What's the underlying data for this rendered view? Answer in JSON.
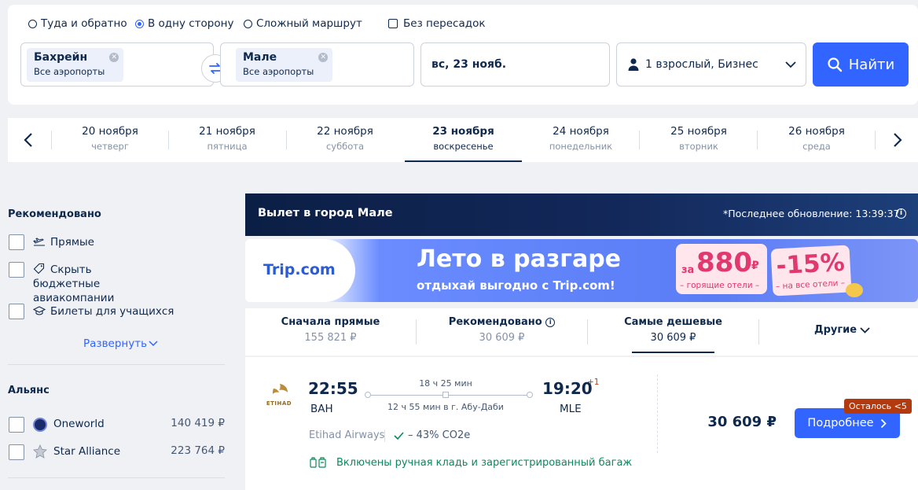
{
  "search": {
    "trip_types": [
      "Туда и обратно",
      "В одну сторону",
      "Сложный маршрут"
    ],
    "nonstop_label": "Без пересадок",
    "from": {
      "city": "Бахрейн",
      "sub": "Все аэропорты"
    },
    "to": {
      "city": "Мале",
      "sub": "Все аэропорты"
    },
    "date": "вс, 23 нояб.",
    "passengers": "1 взрослый, Бизнес",
    "find_label": "Найти"
  },
  "dates": [
    {
      "day": "20 ноября",
      "weekday": "четверг"
    },
    {
      "day": "21 ноября",
      "weekday": "пятница"
    },
    {
      "day": "22 ноября",
      "weekday": "суббота"
    },
    {
      "day": "23 ноября",
      "weekday": "воскресенье"
    },
    {
      "day": "24 ноября",
      "weekday": "понедельник"
    },
    {
      "day": "25 ноября",
      "weekday": "вторник"
    },
    {
      "day": "26 ноября",
      "weekday": "среда"
    }
  ],
  "filters": {
    "recommended_title": "Рекомендовано",
    "recommended": [
      "Прямые",
      "Скрыть бюджетные авиакомпании",
      "Билеты для учащихся"
    ],
    "expand_label": "Развернуть",
    "alliance_title": "Альянс",
    "alliances": [
      {
        "name": "Oneworld",
        "price": "140 419 ₽"
      },
      {
        "name": "Star Alliance",
        "price": "223 764 ₽"
      }
    ]
  },
  "results": {
    "header_title": "Вылет в город Мале",
    "last_update": "*Последнее обновление: 13:39:37",
    "banner": {
      "logo": "Trip.com",
      "headline": "Лето в разгаре",
      "subline": "отдыхай выгодно с Trip.com!",
      "price_prefix": "за",
      "price": "880",
      "price_currency": "₽",
      "price_note": "– горящие отели –",
      "discount": "-15%",
      "discount_note": "– на все отели –"
    },
    "sort_tabs": [
      {
        "title": "Сначала прямые",
        "price": "155 821 ₽"
      },
      {
        "title": "Рекомендовано",
        "price": "30 609 ₽"
      },
      {
        "title": "Самые дешевые",
        "price": "30 609 ₽"
      },
      {
        "title": "Другие",
        "price": ""
      }
    ],
    "flight": {
      "logo_text": "ETIHAD",
      "dep_time": "22:55",
      "dep_code": "BAH",
      "duration": "18 ч 25 мин",
      "stop": "12 ч 55 мин в г. Абу-Даби",
      "arr_time": "19:20",
      "arr_plus": "+1",
      "arr_code": "MLE",
      "airline": "Etihad Airways",
      "co2": "– 43% CO2e",
      "baggage": "Включены ручная кладь и зарегистрированный багаж",
      "price": "30 609 ₽",
      "badge": "Осталось <5",
      "details_label": "Подробнее"
    }
  }
}
